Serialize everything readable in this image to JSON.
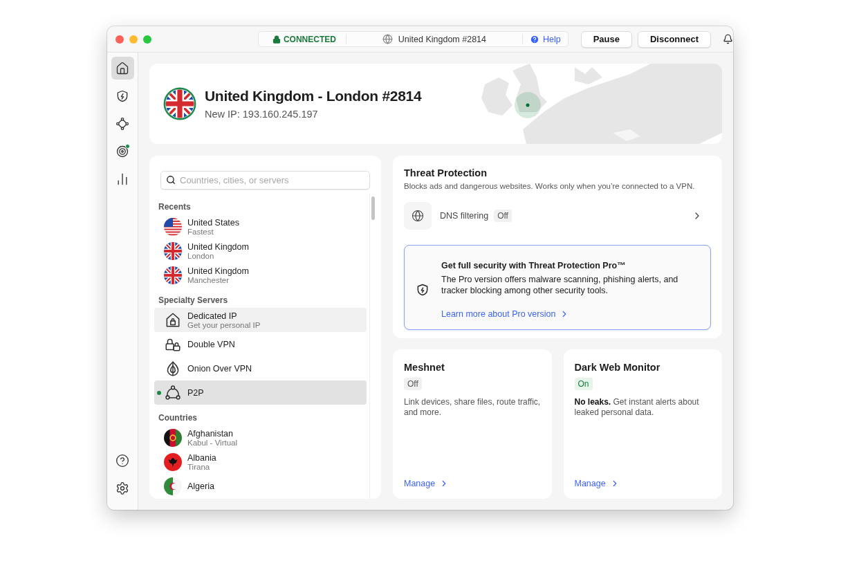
{
  "status_bar": {
    "status": "CONNECTED",
    "server": "United Kingdom #2814",
    "help": "Help"
  },
  "buttons": [
    {
      "label": "Pause"
    },
    {
      "label": "Disconnect"
    }
  ],
  "sidebar": {
    "items": [
      {
        "selected": true,
        "dot": false
      },
      {
        "selected": false,
        "dot": false
      },
      {
        "selected": false,
        "dot": false
      },
      {
        "selected": false,
        "dot": true
      },
      {
        "selected": false,
        "dot": false
      }
    ],
    "bottom_items": [
      {
        "selected": false,
        "dot": false
      },
      {
        "selected": false,
        "dot": false
      }
    ]
  },
  "connection": {
    "title": "United Kingdom - London #2814",
    "ip": "New IP: 193.160.245.197"
  },
  "search": {
    "placeholder": "Countries, cities, or servers"
  },
  "server_list": {
    "sections": [
      {
        "title": "Recents",
        "items": [
          {
            "kind": "location",
            "name": "United States",
            "detail": "Fastest",
            "selected": false,
            "hovered": false,
            "connected": false
          },
          {
            "kind": "location",
            "name": "United Kingdom",
            "detail": "London",
            "selected": false,
            "hovered": false,
            "connected": false
          },
          {
            "kind": "location",
            "name": "United Kingdom",
            "detail": "Manchester",
            "selected": false,
            "hovered": false,
            "connected": false
          }
        ]
      },
      {
        "title": "Specialty Servers",
        "items": [
          {
            "kind": "specialty",
            "name": "Dedicated IP",
            "detail": "Get your personal IP",
            "selected": false,
            "hovered": true,
            "connected": false
          },
          {
            "kind": "specialty",
            "name": "Double VPN",
            "selected": false,
            "hovered": false,
            "connected": false
          },
          {
            "kind": "specialty",
            "name": "Onion Over VPN",
            "selected": false,
            "hovered": false,
            "connected": false
          },
          {
            "kind": "specialty",
            "name": "P2P",
            "selected": true,
            "hovered": false,
            "connected": true
          }
        ]
      },
      {
        "title": "Countries",
        "items": [
          {
            "kind": "location",
            "name": "Afghanistan",
            "detail": "Kabul - Virtual",
            "selected": false,
            "hovered": false,
            "connected": false
          },
          {
            "kind": "location",
            "name": "Albania",
            "detail": "Tirana",
            "selected": false,
            "hovered": false,
            "connected": false
          },
          {
            "kind": "location",
            "name": "Algeria",
            "selected": false,
            "hovered": false,
            "connected": false
          }
        ]
      }
    ]
  },
  "threat_protection": {
    "title": "Threat Protection",
    "description": "Blocks ads and dangerous websites. Works only when you’re connected to a VPN.",
    "dns": {
      "label": "DNS filtering",
      "status": {
        "label": "Off",
        "on": false
      }
    },
    "promo": {
      "title": "Get full security with Threat Protection Pro™",
      "text": "The Pro version offers malware scanning, phishing alerts, and tracker blocking among other security tools.",
      "link": "Learn more about Pro version"
    }
  },
  "cards": [
    {
      "title": "Meshnet",
      "status": {
        "label": "Off",
        "on": false
      },
      "text": "Link devices, share files, route traffic, and more.",
      "link": "Manage"
    },
    {
      "title": "Dark Web Monitor",
      "status": {
        "label": "On",
        "on": true
      },
      "text": "**No leaks.** Get instant alerts about leaked personal data.",
      "link": "Manage"
    }
  ]
}
